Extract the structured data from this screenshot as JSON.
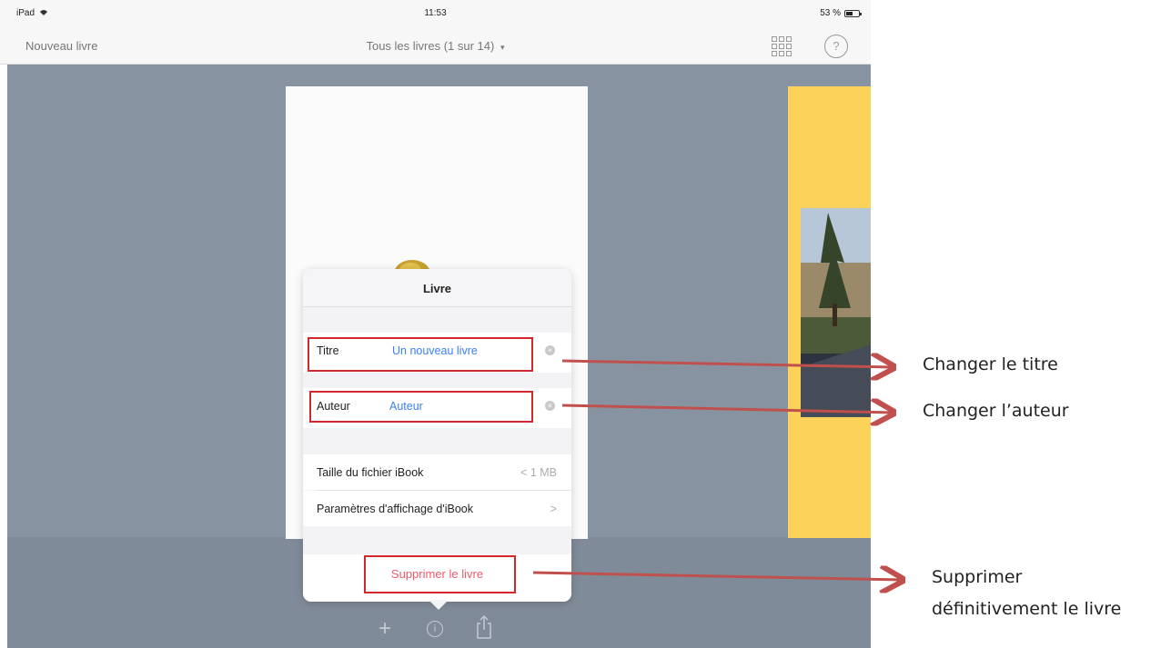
{
  "status_bar": {
    "device": "iPad",
    "wifi_icon": "wifi-icon",
    "time": "11:53",
    "battery": "53 %"
  },
  "nav_bar": {
    "new_book": "Nouveau livre",
    "all_books": "Tous les livres (1 sur 14)",
    "caret": "▾",
    "help": "?"
  },
  "popover": {
    "title": "Livre",
    "fields": [
      {
        "label": "Titre",
        "value": "Un nouveau livre"
      },
      {
        "label": "Auteur",
        "value": "Auteur"
      }
    ],
    "info_rows": [
      {
        "label": "Taille du fichier iBook",
        "value": "< 1 MB"
      },
      {
        "label": "Paramètres d'affichage d'iBook",
        "value": ">"
      }
    ],
    "delete": "Supprimer le livre"
  },
  "toolbar": {
    "add": "+",
    "info": "i"
  },
  "annotations": {
    "title": "Changer le titre",
    "author": "Changer l’auteur",
    "delete_line1": "Supprimer",
    "delete_line2": "définitivement le livre"
  },
  "colors": {
    "accent": "#3a7ff6",
    "danger": "#f05a6b",
    "highlight_box": "#d0282c",
    "arrow": "#c0504d",
    "background": "#8893a1",
    "book_yellow": "#fdd25a"
  }
}
